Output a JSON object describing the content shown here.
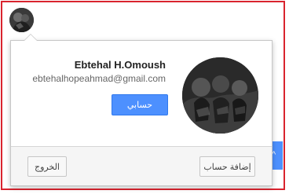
{
  "account_popup": {
    "user_name": "Ebtehal H.Omoush",
    "email": "ebtehalhopeahmad@gmail.com",
    "account_button_label": "حسابي",
    "add_account_label": "إضافة حساب",
    "sign_out_label": "الخروج"
  },
  "icons": {
    "top_avatar": "avatar-icon",
    "profile_photo": "profile-photo",
    "background_chevron": "chevron-up-icon"
  },
  "colors": {
    "frame_border": "#d9232e",
    "primary_button": "#4d90fe",
    "footer_background": "#f5f5f5"
  }
}
